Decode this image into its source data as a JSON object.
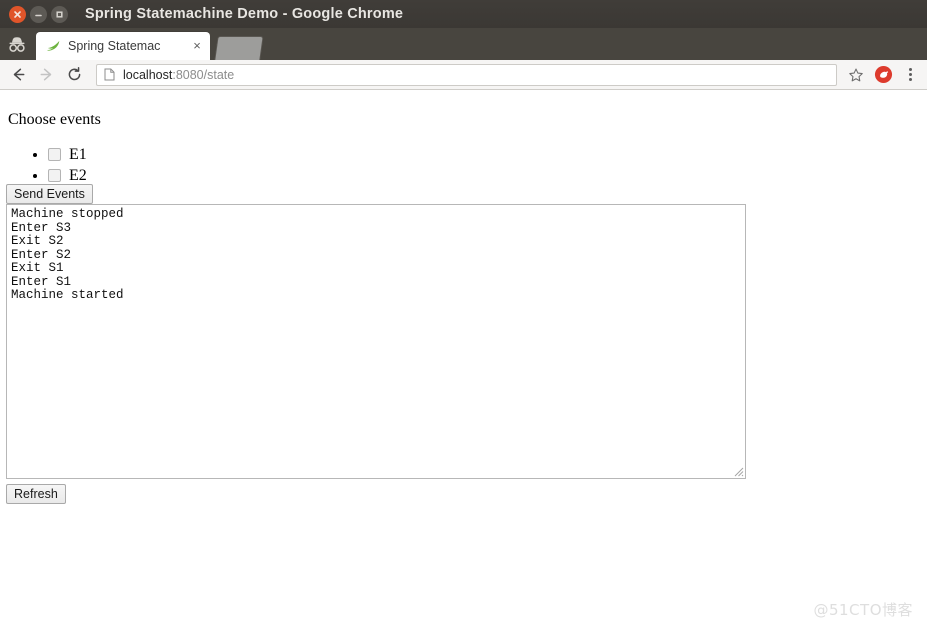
{
  "window": {
    "title": "Spring Statemachine Demo - Google Chrome",
    "controls": {
      "close_label": "close-window",
      "minimize_label": "minimize-window",
      "maximize_label": "maximize-window"
    }
  },
  "tabs": {
    "incognito_icon": "incognito-icon",
    "active": {
      "title": "Spring Statemac",
      "favicon": "spring-leaf-icon",
      "close_label": "×"
    },
    "second": {
      "title": ""
    }
  },
  "toolbar": {
    "back_icon": "back-arrow-icon",
    "forward_icon": "forward-arrow-icon",
    "reload_icon": "reload-icon",
    "page_icon": "page-document-icon",
    "url_host": "localhost",
    "url_path": ":8080/state",
    "url_full": "localhost:8080/state",
    "star_icon": "bookmark-star-icon",
    "extension_icon": "extension-icon",
    "menu_icon": "three-dot-menu-icon"
  },
  "page": {
    "heading": "Choose events",
    "events": [
      {
        "id": "E1",
        "label": "E1",
        "checked": false
      },
      {
        "id": "E2",
        "label": "E2",
        "checked": false
      }
    ],
    "send_button_label": "Send Events",
    "refresh_button_label": "Refresh",
    "log_lines": [
      "Machine stopped",
      "Enter S3",
      "Exit S2",
      "Enter S2",
      "Exit S1",
      "Enter S1",
      "Machine started"
    ],
    "log_text": "Machine stopped\nEnter S3\nExit S2\nEnter S2\nExit S1\nEnter S1\nMachine started"
  },
  "watermark": "@51CTO博客",
  "colors": {
    "titlebar_bg": "#3d3a36",
    "tabstrip_bg": "#48453f",
    "close_button": "#e0552a",
    "spring_green": "#6db33f",
    "extension_red": "#dd3b2d",
    "url_host_text": "#262626",
    "url_path_text": "#8d8d8d"
  }
}
